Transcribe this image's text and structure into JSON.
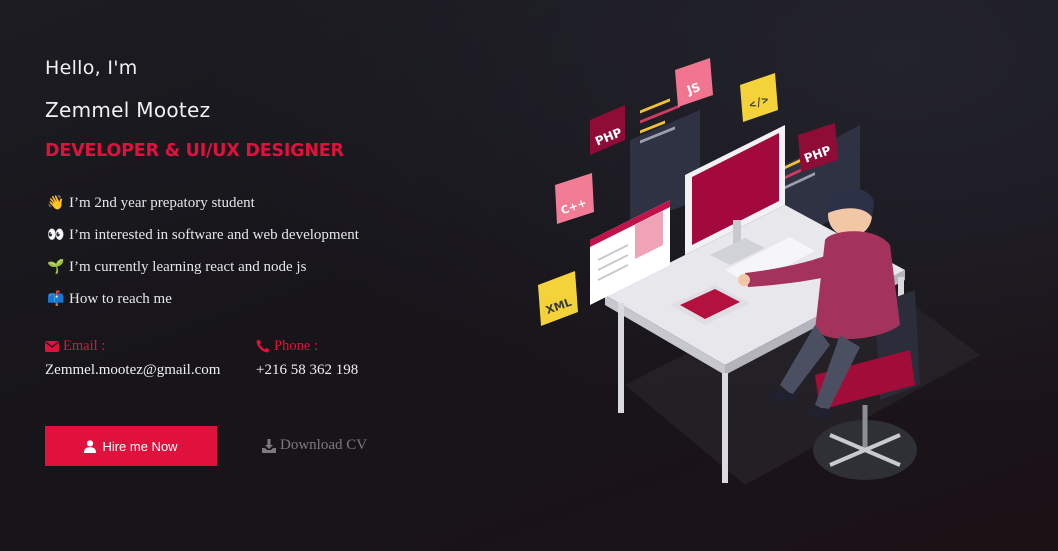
{
  "hero": {
    "greeting": "Hello, I'm",
    "name": "Zemmel Mootez",
    "role": "DEVELOPER & UI/UX DESIGNER",
    "bullets": [
      {
        "icon": "waving-hand-icon",
        "emoji": "👋",
        "text": "I’m 2nd year prepatory student"
      },
      {
        "icon": "eyes-icon",
        "emoji": "👀",
        "text": "I’m interested in software and web development"
      },
      {
        "icon": "seedling-icon",
        "emoji": "🌱",
        "text": "I’m currently learning react and node js"
      },
      {
        "icon": "mailbox-icon",
        "emoji": "📫",
        "text": "How to reach me"
      }
    ]
  },
  "contact": {
    "email_label": "Email :",
    "email_value": "Zemmel.mootez@gmail.com",
    "phone_label": "Phone :",
    "phone_value": "+216 58 362 198"
  },
  "actions": {
    "hire_label": "Hire me Now",
    "download_label": "Download CV"
  },
  "illustration": {
    "badges": [
      "PHP",
      "JS",
      "</>",
      "C++",
      "PHP",
      "XML"
    ]
  },
  "colors": {
    "accent": "#e0113c",
    "background": "#19171c",
    "muted": "#7b7b7f"
  }
}
